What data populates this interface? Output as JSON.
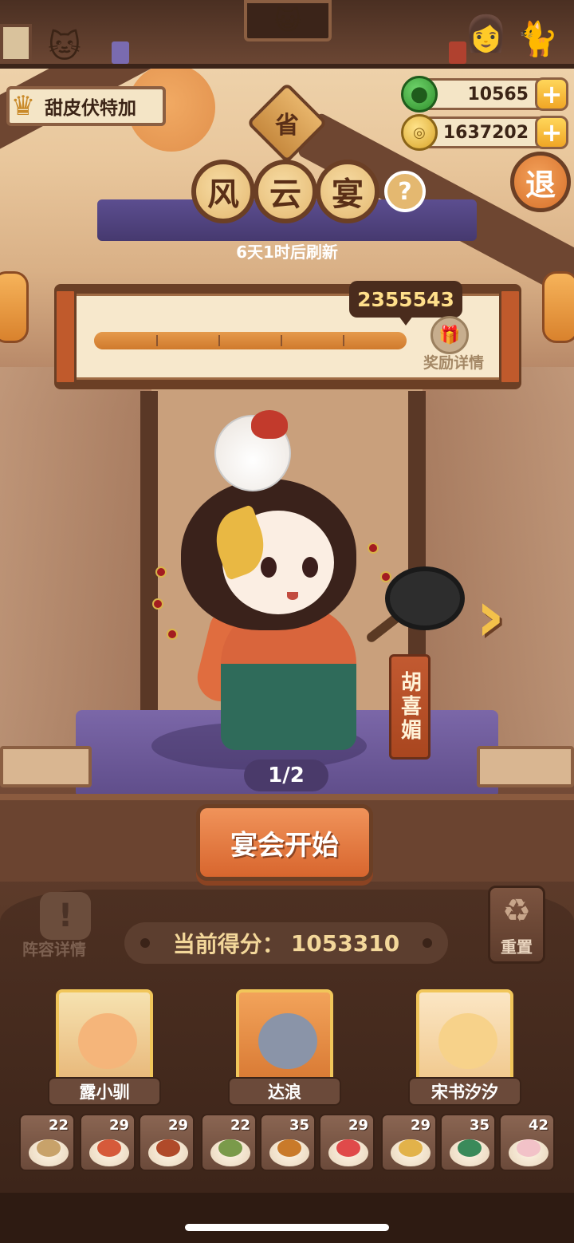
{
  "player": {
    "name": "甜皮伏特加",
    "icon": "chef-trophy-icon"
  },
  "currency": {
    "jade": {
      "icon": "jade-icon",
      "value": "10565",
      "add_label": "+"
    },
    "coin": {
      "icon": "coin-icon",
      "value": "1637202",
      "add_label": "+"
    }
  },
  "event": {
    "province_label": "省",
    "title_chars": [
      "风",
      "云",
      "宴"
    ],
    "help_label": "?",
    "exit_label": "退",
    "refresh_text": "6天1时后刷新"
  },
  "score_board": {
    "target": "2355543",
    "progress": 1,
    "reward_label": "奖励详情",
    "reward_icon": "gift-icon"
  },
  "character": {
    "name": "胡喜媚",
    "page_indicator": "1/2",
    "next_icon": "chevron-right-icon"
  },
  "actions": {
    "start_label": "宴会开始",
    "lineup_label": "阵容详情",
    "lineup_icon": "exclamation-icon",
    "reset_label": "重置",
    "reset_icon": "recycle-icon"
  },
  "score": {
    "label": "当前得分：",
    "value": "1053310"
  },
  "guests": [
    {
      "name": "露小驯",
      "color": "#f5b57a"
    },
    {
      "name": "达浪",
      "color": "#8a94a8"
    },
    {
      "name": "宋书汐汐",
      "color": "#f7d28a"
    }
  ],
  "dishes": [
    {
      "count": "22",
      "color": "#c8a26a"
    },
    {
      "count": "29",
      "color": "#d65a3a"
    },
    {
      "count": "29",
      "color": "#b04a2a"
    },
    {
      "count": "22",
      "color": "#7a9a4a"
    },
    {
      "count": "35",
      "color": "#c97a2a"
    },
    {
      "count": "29",
      "color": "#e04a4a"
    },
    {
      "count": "29",
      "color": "#e2b24a"
    },
    {
      "count": "35",
      "color": "#3a8a5a"
    },
    {
      "count": "42",
      "color": "#f2c2c8"
    }
  ]
}
